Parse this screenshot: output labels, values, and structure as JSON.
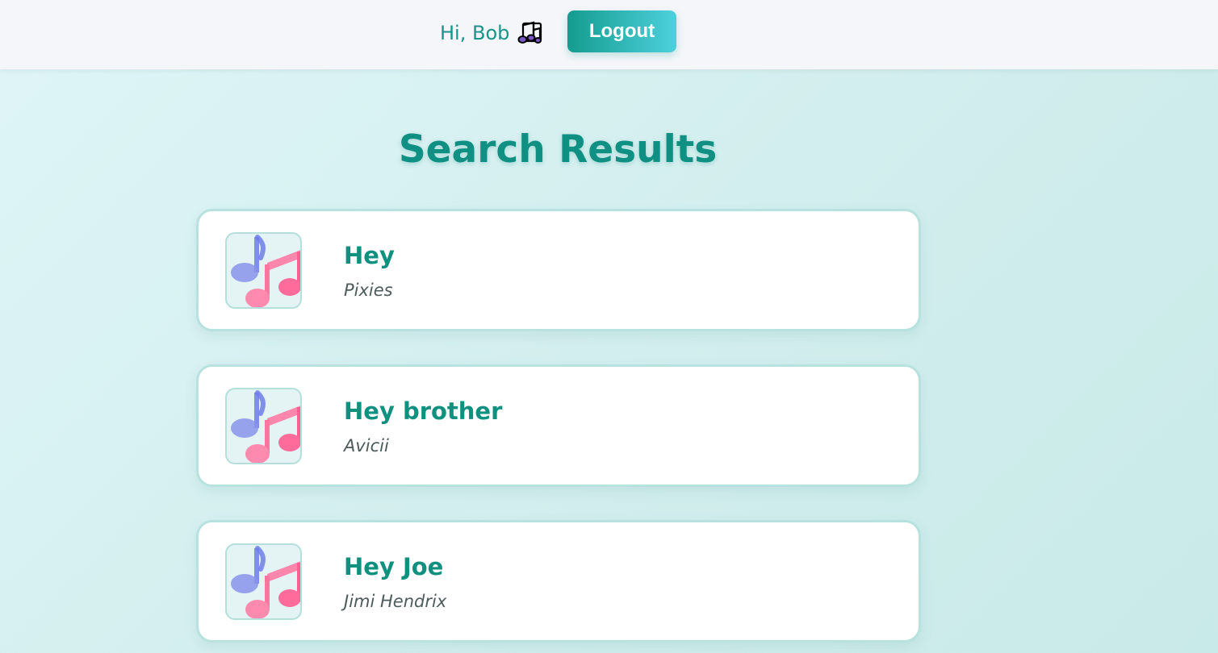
{
  "header": {
    "greeting": "Hi, Bob",
    "greeting_icon": "musical-notes-emoji",
    "logout_label": "Logout"
  },
  "page": {
    "title": "Search Results"
  },
  "results": [
    {
      "title": "Hey",
      "artist": "Pixies",
      "thumbnail_icon": "musical-notes-icon"
    },
    {
      "title": "Hey brother",
      "artist": "Avicii",
      "thumbnail_icon": "musical-notes-icon"
    },
    {
      "title": "Hey Joe",
      "artist": "Jimi Hendrix",
      "thumbnail_icon": "musical-notes-icon"
    }
  ],
  "colors": {
    "accent": "#10907f",
    "button_gradient_start": "#159c8f",
    "button_gradient_end": "#4dd0dc",
    "note_blue": "#6f7de8",
    "note_pink": "#ff5f93"
  }
}
